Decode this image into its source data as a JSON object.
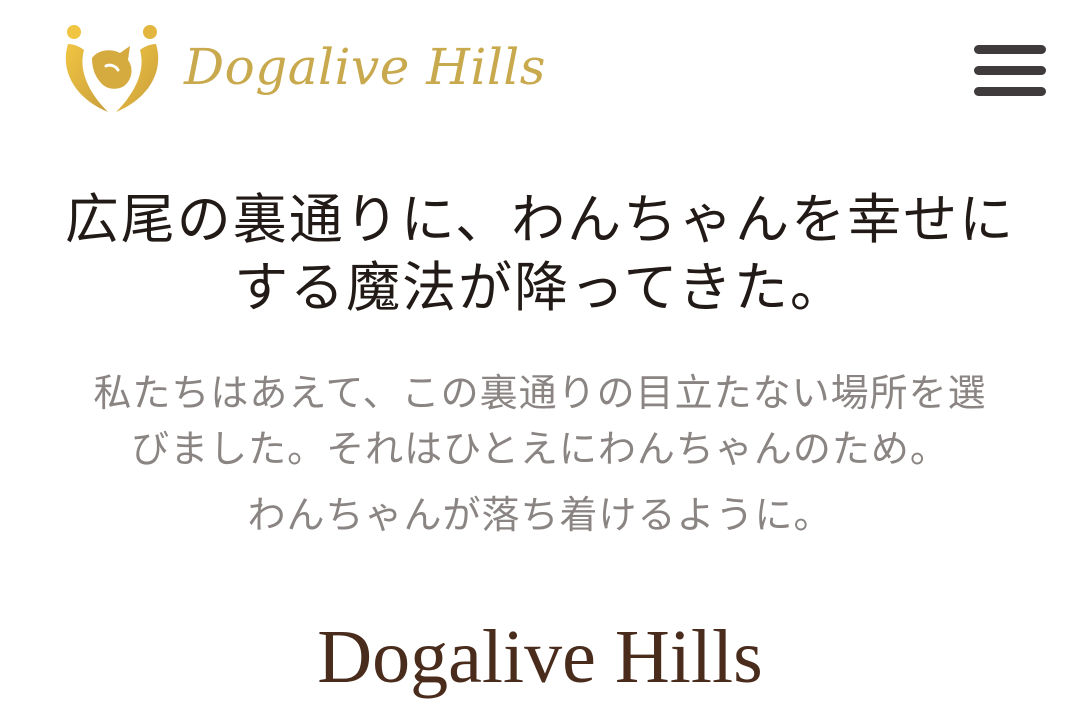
{
  "header": {
    "logo_text": "Dogalive Hills",
    "logo_icon": "dog-heart-logo-icon",
    "menu_icon": "hamburger-menu-icon"
  },
  "hero": {
    "headline_line1": "広尾の裏通りに、わんちゃんを幸せに",
    "headline_line2": "する魔法が降ってきた。",
    "lead_line1": "私たちはあえて、この裏通りの目立たない場所を選",
    "lead_line2": "びました。それはひとえにわんちゃんのため。",
    "sub": "わんちゃんが落ち着けるように。"
  },
  "section": {
    "brand_heading": "Dogalive Hills"
  },
  "colors": {
    "brand_gold": "#c9a94d",
    "brand_gold_light": "#e6bd3f",
    "menu": "#3f3a3b",
    "headline": "#221a16",
    "body_text": "#8a8583",
    "brand_heading": "#4a2c1d"
  }
}
